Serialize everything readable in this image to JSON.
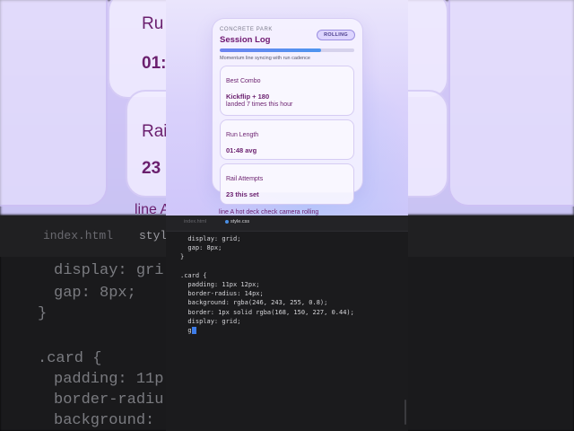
{
  "app": {
    "eyebrow": "CONCRETE PARK",
    "title": "Session Log",
    "status_badge": "ROLLING",
    "progress": 0.75,
    "subtitle": "Momentum line syncing with run cadence",
    "cards": [
      {
        "label": "Best Combo",
        "value": "Kickflip + 180",
        "sub": "landed 7 times this hour"
      },
      {
        "label": "Run Length",
        "value": "01:48 avg",
        "sub": ""
      },
      {
        "label": "Rail Attempts",
        "value": "23 this set",
        "sub": ""
      }
    ],
    "overflow_text": "line A hot deck check camera rolling"
  },
  "editor": {
    "tabs": [
      {
        "label": "index.html",
        "active": false
      },
      {
        "label": "style.css",
        "active": true
      }
    ],
    "code_lines": [
      "  display: grid;",
      "  gap: 8px;",
      "}",
      "",
      ".card {",
      "  padding: 11px 12px;",
      "  border-radius: 14px;",
      "  background: rgba(246, 243, 255, 0.8);",
      "  border: 1px solid rgba(168, 150, 227, 0.44);",
      "  display: grid;",
      "  g"
    ]
  },
  "background": {
    "card_texts": [
      "Ru",
      "01:",
      "Rail",
      "23"
    ],
    "overflow_text": "line A",
    "tabs": [
      "index.html",
      "style"
    ],
    "code_lines": [
      "display: gri",
      "gap: 8px;",
      "}",
      "",
      ".card {",
      "padding: 11p",
      "border-radiu",
      "background:"
    ]
  },
  "colors": {
    "accent": "#6e1670",
    "progress": "#4e95ef",
    "badge_bg": "#ddd5ff",
    "editor_bg": "#1b1b1d",
    "cursor": "#3d7ce8"
  }
}
